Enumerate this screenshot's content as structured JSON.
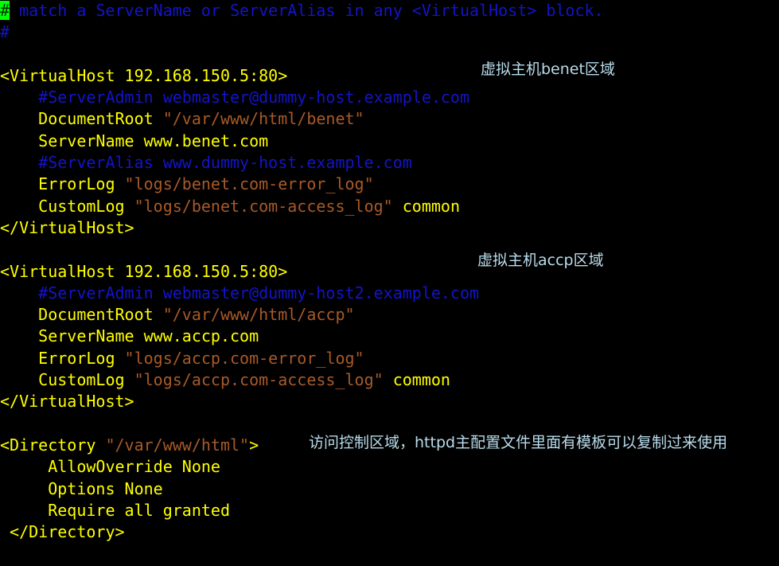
{
  "editor": {
    "background_color": "#000000",
    "cursor_color": "#00FF00",
    "colors": {
      "comment": "#1414C8",
      "directive": "#FFFF00",
      "string": "#A85A28",
      "annotation": "#B9DCEC"
    },
    "cursor_char": "#",
    "lines": [
      {
        "id": "l1",
        "indent": "",
        "segments": [
          {
            "text": "#",
            "style": "cursor"
          },
          {
            "text": " match a ServerName or ServerAlias in any <VirtualHost> block.",
            "style": "comment"
          }
        ]
      },
      {
        "id": "l2",
        "indent": "",
        "segments": [
          {
            "text": "#",
            "style": "comment"
          }
        ]
      },
      {
        "id": "l3",
        "indent": "",
        "segments": [
          {
            "text": "",
            "style": "plain"
          }
        ]
      },
      {
        "id": "l4",
        "indent": "",
        "segments": [
          {
            "text": "<VirtualHost 192.168.150.5:80>",
            "style": "directive"
          }
        ]
      },
      {
        "id": "l5",
        "indent": "    ",
        "segments": [
          {
            "text": "#ServerAdmin webmaster@dummy-host.example.com",
            "style": "comment"
          }
        ]
      },
      {
        "id": "l6",
        "indent": "    ",
        "segments": [
          {
            "text": "DocumentRoot ",
            "style": "directive"
          },
          {
            "text": "\"/var/www/html/benet\"",
            "style": "string"
          }
        ]
      },
      {
        "id": "l7",
        "indent": "    ",
        "segments": [
          {
            "text": "ServerName www.benet.com",
            "style": "directive"
          }
        ]
      },
      {
        "id": "l8",
        "indent": "    ",
        "segments": [
          {
            "text": "#ServerAlias www.dummy-host.example.com",
            "style": "comment"
          }
        ]
      },
      {
        "id": "l9",
        "indent": "    ",
        "segments": [
          {
            "text": "ErrorLog ",
            "style": "directive"
          },
          {
            "text": "\"logs/benet.com-error_log\"",
            "style": "string"
          }
        ]
      },
      {
        "id": "l10",
        "indent": "    ",
        "segments": [
          {
            "text": "CustomLog ",
            "style": "directive"
          },
          {
            "text": "\"logs/benet.com-access_log\"",
            "style": "string"
          },
          {
            "text": " common",
            "style": "directive"
          }
        ]
      },
      {
        "id": "l11",
        "indent": "",
        "segments": [
          {
            "text": "</VirtualHost>",
            "style": "directive"
          }
        ]
      },
      {
        "id": "l12",
        "indent": "",
        "segments": [
          {
            "text": "",
            "style": "plain"
          }
        ]
      },
      {
        "id": "l13",
        "indent": "",
        "segments": [
          {
            "text": "<VirtualHost 192.168.150.5:80>",
            "style": "directive"
          }
        ]
      },
      {
        "id": "l14",
        "indent": "    ",
        "segments": [
          {
            "text": "#ServerAdmin webmaster@dummy-host2.example.com",
            "style": "comment"
          }
        ]
      },
      {
        "id": "l15",
        "indent": "    ",
        "segments": [
          {
            "text": "DocumentRoot ",
            "style": "directive"
          },
          {
            "text": "\"/var/www/html/accp\"",
            "style": "string"
          }
        ]
      },
      {
        "id": "l16",
        "indent": "    ",
        "segments": [
          {
            "text": "ServerName www.accp.com",
            "style": "directive"
          }
        ]
      },
      {
        "id": "l17",
        "indent": "    ",
        "segments": [
          {
            "text": "ErrorLog ",
            "style": "directive"
          },
          {
            "text": "\"logs/accp.com-error_log\"",
            "style": "string"
          }
        ]
      },
      {
        "id": "l18",
        "indent": "    ",
        "segments": [
          {
            "text": "CustomLog ",
            "style": "directive"
          },
          {
            "text": "\"logs/accp.com-access_log\"",
            "style": "string"
          },
          {
            "text": " common",
            "style": "directive"
          }
        ]
      },
      {
        "id": "l19",
        "indent": "",
        "segments": [
          {
            "text": "</VirtualHost>",
            "style": "directive"
          }
        ]
      },
      {
        "id": "l20",
        "indent": "",
        "segments": [
          {
            "text": "",
            "style": "plain"
          }
        ]
      },
      {
        "id": "l21",
        "indent": "",
        "segments": [
          {
            "text": "<Directory ",
            "style": "directive"
          },
          {
            "text": "\"/var/www/html\"",
            "style": "string"
          },
          {
            "text": ">",
            "style": "directive"
          }
        ]
      },
      {
        "id": "l22",
        "indent": "     ",
        "segments": [
          {
            "text": "AllowOverride None",
            "style": "directive"
          }
        ]
      },
      {
        "id": "l23",
        "indent": "     ",
        "segments": [
          {
            "text": "Options None",
            "style": "directive"
          }
        ]
      },
      {
        "id": "l24",
        "indent": "     ",
        "segments": [
          {
            "text": "Require all granted",
            "style": "directive"
          }
        ]
      },
      {
        "id": "l25",
        "indent": " ",
        "segments": [
          {
            "text": "</Directory>",
            "style": "directive"
          }
        ]
      }
    ]
  },
  "annotations": {
    "benet": "虚拟主机benet区域",
    "accp": "虚拟主机accp区域",
    "directory": "访问控制区域，httpd主配置文件里面有模板可以复制过来使用"
  }
}
